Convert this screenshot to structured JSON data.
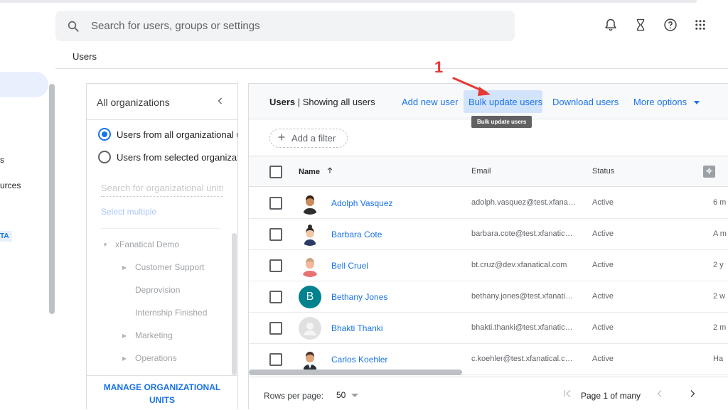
{
  "header": {
    "search_placeholder": "Search for users, groups or settings",
    "icons": [
      "bell-icon",
      "hourglass-icon",
      "help-icon",
      "apps-grid-icon"
    ]
  },
  "breadcrumb": "Users",
  "nav": {
    "fragments": [
      "s",
      "urces"
    ],
    "badge": "TA"
  },
  "orgs": {
    "title": "All organizations",
    "radio_all": "Users from all organizational units",
    "radio_selected": "Users from selected organizational units",
    "search_placeholder": "Search for organizational units",
    "select_multiple": "Select multiple",
    "tree": {
      "root": "xFanatical Demo",
      "children": [
        "Customer Support",
        "Deprovision",
        "Internship Finished",
        "Marketing",
        "Operations"
      ]
    },
    "manage_line1": "MANAGE ORGANIZATIONAL",
    "manage_line2": "UNITS"
  },
  "users": {
    "title_bold": "Users",
    "title_rest": " | Showing all users",
    "add_new": "Add new user",
    "bulk_update": "Bulk update users",
    "download": "Download users",
    "more_options": "More options",
    "tooltip": "Bulk update users",
    "add_filter": "Add a filter",
    "columns": {
      "name": "Name",
      "email": "Email",
      "status": "Status"
    },
    "rows": [
      {
        "name": "Adolph Vasquez",
        "email": "adolph.vasquez@test.xfana…",
        "status": "Active",
        "last": "6 m"
      },
      {
        "name": "Barbara Cote",
        "email": "barbara.cote@test.xfanatic…",
        "status": "Active",
        "last": "A m"
      },
      {
        "name": "Bell Cruel",
        "email": "bt.cruz@dev.xfanatical.com",
        "status": "Active",
        "last": "2 y"
      },
      {
        "name": "Bethany Jones",
        "email": "bethany.jones@test.xfanati…",
        "status": "Active",
        "last": "2 w",
        "initial": "B"
      },
      {
        "name": "Bhakti Thanki",
        "email": "bhakti.thanki@test.xfanatic…",
        "status": "Active",
        "last": "2 m"
      },
      {
        "name": "Carlos Koehler",
        "email": "c.koehler@test.xfanatical.c…",
        "status": "Active",
        "last": "Ha"
      }
    ],
    "footer": {
      "rows_per_page": "Rows per page:",
      "rows_value": "50",
      "page": "Page 1 of many"
    }
  },
  "annotation": {
    "number": "1",
    "color": "#e53935"
  },
  "colors": {
    "accent": "#1a73e8",
    "highlight": "#d2e3fc",
    "tooltip_bg": "#616161"
  }
}
